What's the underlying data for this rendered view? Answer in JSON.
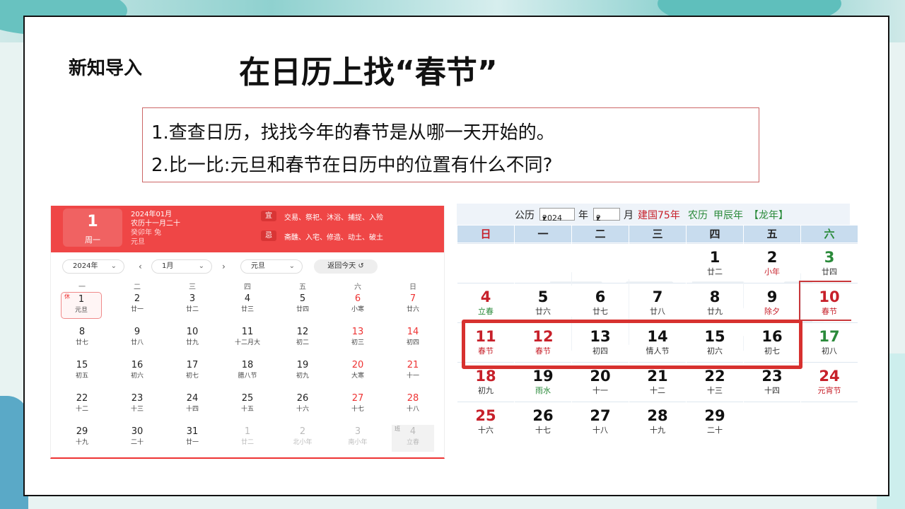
{
  "slide": {
    "label": "新知导入",
    "title": "在日历上找“春节”",
    "questions": [
      "1.查查日历，找找今年的春节是从哪一天开始的。",
      "2.比一比:元旦和春节在日历中的位置有什么不同?"
    ]
  },
  "left_calendar": {
    "day": "1",
    "weekday": "周一",
    "info": [
      "2024年01月",
      "农历十一月二十",
      "癸卯年 兔",
      "元旦"
    ],
    "yi_label": "宜",
    "yi": "交易、祭祀、沐浴、捕捉、入殓",
    "ji_label": "忌",
    "ji": "斋醮、入宅、修造、动土、破土",
    "year_select": "2024年",
    "month_select": "1月",
    "holiday_select": "元旦",
    "today_button": "返回今天 ↺",
    "prev_icon": "‹",
    "next_icon": "›",
    "dropdown_icon": "⌄",
    "weekdays": [
      "一",
      "二",
      "三",
      "四",
      "五",
      "六",
      "日"
    ],
    "rest_mark": "休",
    "work_mark": "班",
    "weeks": [
      [
        [
          "1",
          "元旦"
        ],
        [
          "2",
          "廿一"
        ],
        [
          "3",
          "廿二"
        ],
        [
          "4",
          "廿三"
        ],
        [
          "5",
          "廿四"
        ],
        [
          "6",
          "小寒"
        ],
        [
          "7",
          "廿六"
        ]
      ],
      [
        [
          "8",
          "廿七"
        ],
        [
          "9",
          "廿八"
        ],
        [
          "10",
          "廿九"
        ],
        [
          "11",
          "十二月大"
        ],
        [
          "12",
          "初二"
        ],
        [
          "13",
          "初三"
        ],
        [
          "14",
          "初四"
        ]
      ],
      [
        [
          "15",
          "初五"
        ],
        [
          "16",
          "初六"
        ],
        [
          "17",
          "初七"
        ],
        [
          "18",
          "腊八节"
        ],
        [
          "19",
          "初九"
        ],
        [
          "20",
          "大寒"
        ],
        [
          "21",
          "十一"
        ]
      ],
      [
        [
          "22",
          "十二"
        ],
        [
          "23",
          "十三"
        ],
        [
          "24",
          "十四"
        ],
        [
          "25",
          "十五"
        ],
        [
          "26",
          "十六"
        ],
        [
          "27",
          "十七"
        ],
        [
          "28",
          "十八"
        ]
      ],
      [
        [
          "29",
          "十九"
        ],
        [
          "30",
          "二十"
        ],
        [
          "31",
          "廿一"
        ],
        [
          "1",
          "廿二"
        ],
        [
          "2",
          "北小年"
        ],
        [
          "3",
          "南小年"
        ],
        [
          "4",
          "立春"
        ]
      ]
    ]
  },
  "right_calendar": {
    "top": {
      "gongli": "公历",
      "year": "2024",
      "year_unit": "年",
      "month": "2",
      "month_unit": "月",
      "jianguo": "建国75年",
      "nongli": "农历",
      "ganzhi": "甲辰年",
      "zodiac": "【龙年】",
      "dropdown_icon": "▾"
    },
    "weekdays": [
      "日",
      "一",
      "二",
      "三",
      "四",
      "五",
      "六"
    ],
    "watermark": "2024",
    "weeks": [
      [
        [
          "",
          ""
        ],
        [
          "",
          ""
        ],
        [
          "",
          ""
        ],
        [
          "",
          ""
        ],
        [
          "1",
          "廿二"
        ],
        [
          "2",
          "小年"
        ],
        [
          "3",
          "廿四"
        ]
      ],
      [
        [
          "4",
          "立春"
        ],
        [
          "5",
          "廿六"
        ],
        [
          "6",
          "廿七"
        ],
        [
          "7",
          "廿八"
        ],
        [
          "8",
          "廿九"
        ],
        [
          "9",
          "除夕"
        ],
        [
          "10",
          "春节"
        ]
      ],
      [
        [
          "11",
          "春节"
        ],
        [
          "12",
          "春节"
        ],
        [
          "13",
          "初四"
        ],
        [
          "14",
          "情人节"
        ],
        [
          "15",
          "初六"
        ],
        [
          "16",
          "初七"
        ],
        [
          "17",
          "初八"
        ]
      ],
      [
        [
          "18",
          "初九"
        ],
        [
          "19",
          "雨水"
        ],
        [
          "20",
          "十一"
        ],
        [
          "21",
          "十二"
        ],
        [
          "22",
          "十三"
        ],
        [
          "23",
          "十四"
        ],
        [
          "24",
          "元宵节"
        ]
      ],
      [
        [
          "25",
          "十六"
        ],
        [
          "26",
          "十七"
        ],
        [
          "27",
          "十八"
        ],
        [
          "28",
          "十九"
        ],
        [
          "29",
          "二十"
        ],
        [
          "",
          ""
        ],
        [
          "",
          ""
        ]
      ]
    ],
    "colors": {
      "holiday_red": "#c7202a",
      "weekend_green": "#2a8a3a",
      "highlight_box": "#d7312f"
    }
  }
}
